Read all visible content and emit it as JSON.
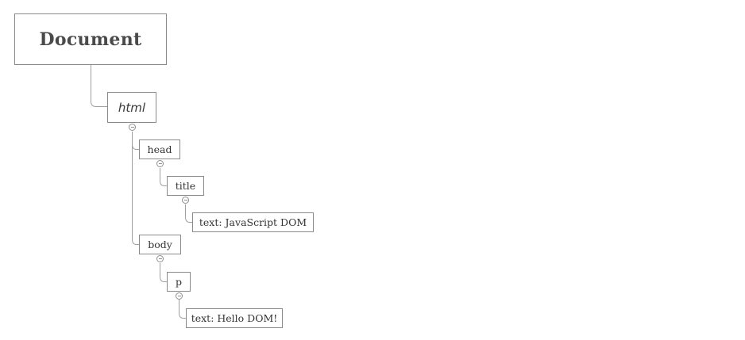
{
  "diagram": {
    "root": {
      "label": "Document"
    },
    "html": {
      "label": "html"
    },
    "head": {
      "label": "head"
    },
    "title": {
      "label": "title"
    },
    "title_text": {
      "label": "text: JavaScript DOM"
    },
    "body": {
      "label": "body"
    },
    "p": {
      "label": "p"
    },
    "p_text": {
      "label": "text: Hello DOM!"
    }
  },
  "colors": {
    "border": "#8a8a8a",
    "connector": "#a0a0a0",
    "text": "#333333"
  },
  "icons": {
    "collapse": "minus-circle-icon"
  }
}
